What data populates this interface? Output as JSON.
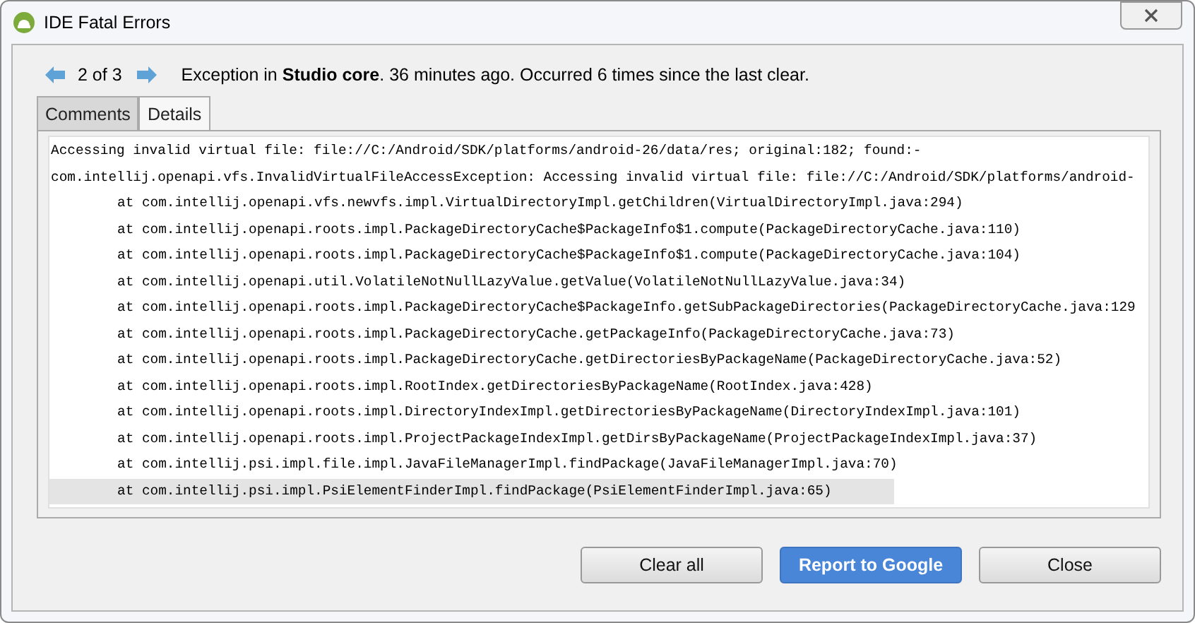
{
  "window": {
    "title": "IDE Fatal Errors"
  },
  "navigator": {
    "position": "2 of 3",
    "message": "Exception in **Studio core**. 36 minutes ago. Occurred 6 times since the last clear."
  },
  "tabs": [
    {
      "label": "Comments",
      "selected": false
    },
    {
      "label": "Details",
      "selected": true
    }
  ],
  "details": {
    "lines": [
      {
        "kind": "message",
        "text": "Accessing invalid virtual file: file://C:/Android/SDK/platforms/android-26/data/res; original:182; found:-",
        "highlighted": false
      },
      {
        "kind": "message",
        "text": "com.intellij.openapi.vfs.InvalidVirtualFileAccessException: Accessing invalid virtual file: file://C:/Android/SDK/platforms/android-",
        "highlighted": false
      },
      {
        "kind": "frame",
        "text": "at com.intellij.openapi.vfs.newvfs.impl.VirtualDirectoryImpl.getChildren(VirtualDirectoryImpl.java:294)",
        "highlighted": false
      },
      {
        "kind": "frame",
        "text": "at com.intellij.openapi.roots.impl.PackageDirectoryCache$PackageInfo$1.compute(PackageDirectoryCache.java:110)",
        "highlighted": false
      },
      {
        "kind": "frame",
        "text": "at com.intellij.openapi.roots.impl.PackageDirectoryCache$PackageInfo$1.compute(PackageDirectoryCache.java:104)",
        "highlighted": false
      },
      {
        "kind": "frame",
        "text": "at com.intellij.openapi.util.VolatileNotNullLazyValue.getValue(VolatileNotNullLazyValue.java:34)",
        "highlighted": false
      },
      {
        "kind": "frame",
        "text": "at com.intellij.openapi.roots.impl.PackageDirectoryCache$PackageInfo.getSubPackageDirectories(PackageDirectoryCache.java:129",
        "highlighted": false
      },
      {
        "kind": "frame",
        "text": "at com.intellij.openapi.roots.impl.PackageDirectoryCache.getPackageInfo(PackageDirectoryCache.java:73)",
        "highlighted": false
      },
      {
        "kind": "frame",
        "text": "at com.intellij.openapi.roots.impl.PackageDirectoryCache.getDirectoriesByPackageName(PackageDirectoryCache.java:52)",
        "highlighted": false
      },
      {
        "kind": "frame",
        "text": "at com.intellij.openapi.roots.impl.RootIndex.getDirectoriesByPackageName(RootIndex.java:428)",
        "highlighted": false
      },
      {
        "kind": "frame",
        "text": "at com.intellij.openapi.roots.impl.DirectoryIndexImpl.getDirectoriesByPackageName(DirectoryIndexImpl.java:101)",
        "highlighted": false
      },
      {
        "kind": "frame",
        "text": "at com.intellij.openapi.roots.impl.ProjectPackageIndexImpl.getDirsByPackageName(ProjectPackageIndexImpl.java:37)",
        "highlighted": false
      },
      {
        "kind": "frame",
        "text": "at com.intellij.psi.impl.file.impl.JavaFileManagerImpl.findPackage(JavaFileManagerImpl.java:70)",
        "highlighted": false
      },
      {
        "kind": "frame",
        "text": "at com.intellij.psi.impl.PsiElementFinderImpl.findPackage(PsiElementFinderImpl.java:65)",
        "highlighted": true
      }
    ]
  },
  "buttons": [
    {
      "label": "Clear all",
      "kind": "normal"
    },
    {
      "label": "Report to Google",
      "kind": "primary"
    },
    {
      "label": "Close",
      "kind": "normal"
    }
  ]
}
